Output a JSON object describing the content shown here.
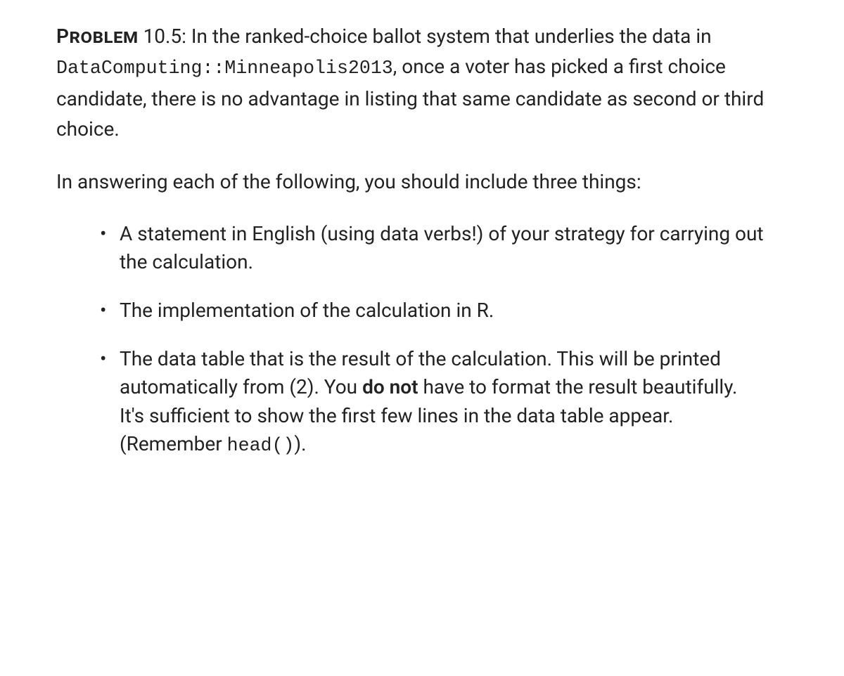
{
  "problem": {
    "label": "Problem",
    "number": "10.5",
    "intro_before_code": ": In the ranked-choice ballot system that underlies the data in ",
    "code_ref": "DataComputing::Minneapolis2013",
    "intro_after_code": ", once a voter has picked a first choice candidate, there is no advantage in listing that same candidate as second or third choice."
  },
  "instruction": "In answering each of the following, you should include three things:",
  "bullets": [
    {
      "text_plain": "A statement in English (using data verbs!) of your strategy for carrying out the calculation."
    },
    {
      "text_plain": "The implementation of the calculation in R."
    },
    {
      "prefix": "The data table that is the result of the calculation. This will be printed automatically from (2). You ",
      "bold": "do not",
      "mid": " have to format the result beautifully. It's sufficient to show the first few lines in the data table appear. (Remember ",
      "code": "head()",
      "suffix": ")."
    }
  ]
}
